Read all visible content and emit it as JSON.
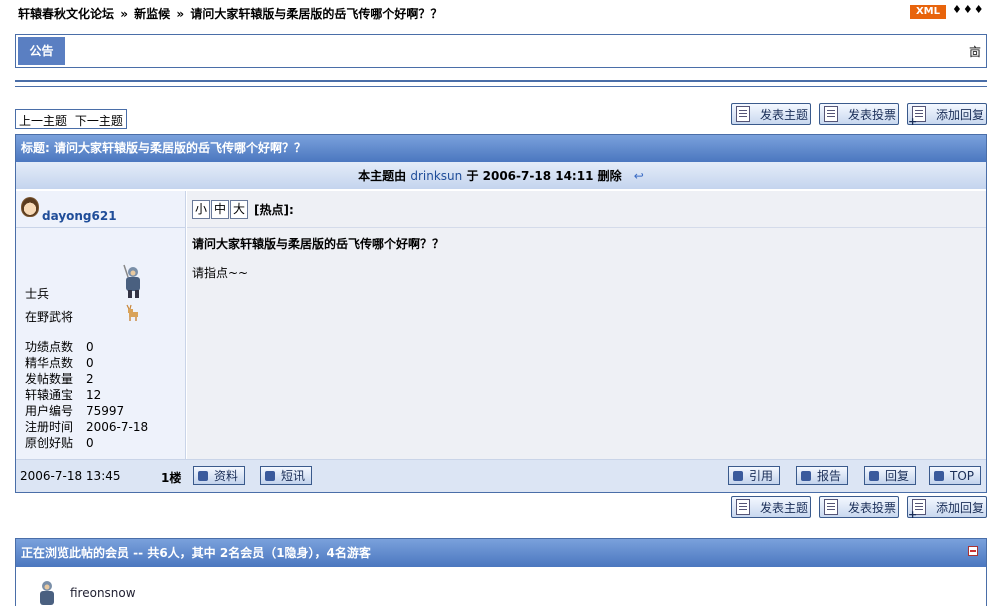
{
  "breadcrumb": {
    "forum": "轩辕春秋文化论坛",
    "sep1": "»",
    "board": "新监候",
    "sep2": "»",
    "topic": "请问大家轩辕版与柔居版的岳飞传哪个好啊？？"
  },
  "header": {
    "xml_badge": "XML",
    "arrows": "♦♦♦"
  },
  "announcement": {
    "label": "公告",
    "scroll_icon": "㐭"
  },
  "topic_nav": {
    "prev": "上一主题",
    "next": "下一主题"
  },
  "actions": {
    "new_topic": "发表主题",
    "new_poll": "发表投票",
    "reply": "添加回复"
  },
  "post": {
    "title_bar": "标题: 请问大家轩辕版与柔居版的岳飞传哪个好啊？？",
    "edit_note_prefix": "本主题由",
    "edit_user": "drinksun",
    "edit_note_mid": "于 2006-7-18 14:11 删除",
    "back_icon": "↩",
    "author": "dayong621",
    "rank_title": "士兵",
    "rank_sub": "在野武将",
    "stats": [
      {
        "key": "功绩点数",
        "value": "0"
      },
      {
        "key": "精华点数",
        "value": "0"
      },
      {
        "key": "发帖数量",
        "value": "2"
      },
      {
        "key": "轩辕通宝",
        "value": "12"
      },
      {
        "key": "用户编号",
        "value": "75997"
      },
      {
        "key": "注册时间",
        "value": "2006-7-18"
      },
      {
        "key": "原创好贴",
        "value": "0"
      }
    ],
    "size_small": "小",
    "size_medium": "中",
    "size_large": "大",
    "hot_label": "[热点]:",
    "subject": "请问大家轩辕版与柔居版的岳飞传哪个好啊？？",
    "body": "请指点~~",
    "date": "2006-7-18 13:45",
    "floor": "1楼",
    "profile_btn": "资料",
    "pm_btn": "短讯",
    "quote_btn": "引用",
    "report_btn": "报告",
    "reply_btn": "回复",
    "top_btn": "TOP"
  },
  "viewers": {
    "header": "正在浏览此帖的会员 -- 共6人，其中 2名会员（1隐身），4名游客",
    "member": "fireonsnow"
  }
}
